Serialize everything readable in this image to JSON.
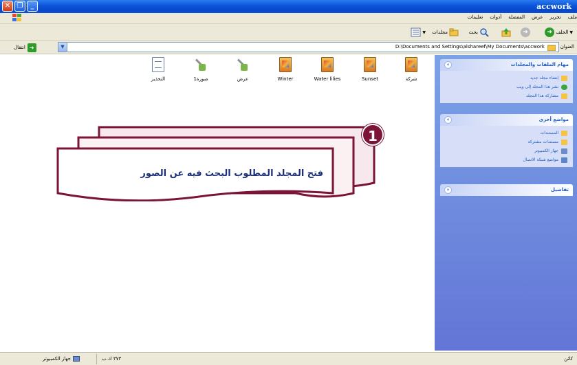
{
  "window": {
    "title": "accwork"
  },
  "menu": [
    "ملف",
    "تحرير",
    "عرض",
    "المفضلة",
    "أدوات",
    "تعليمات"
  ],
  "toolbar": {
    "back_label": "الخلف",
    "search_label": "بحث",
    "folders_label": "مجلدات"
  },
  "address": {
    "label": "العنوان",
    "path": "D:\\Documents and Settings\\alshareef\\My Documents\\accwork",
    "go_label": "انتقال"
  },
  "task_pane": {
    "panels": [
      {
        "title": "مهام الملفات والمجلدات",
        "tasks": [
          {
            "label": "إنشاء مجلد جديد",
            "icon": "new-folder-icon",
            "color": "#f5c445"
          },
          {
            "label": "نشر هذا المجلد إلى ويب",
            "icon": "web-publish-icon",
            "color": "#3aa63a"
          },
          {
            "label": "مشاركة هذا المجلد",
            "icon": "share-folder-icon",
            "color": "#f5c445"
          }
        ]
      },
      {
        "title": "مواضع أخرى",
        "tasks": [
          {
            "label": "المستندات",
            "icon": "documents-icon",
            "color": "#f5c445"
          },
          {
            "label": "مستندات مشتركة",
            "icon": "shared-documents-icon",
            "color": "#f5c445"
          },
          {
            "label": "جهاز الكمبيوتر",
            "icon": "my-computer-icon",
            "color": "#6b8bc9"
          },
          {
            "label": "مواضع شبكة الاتصال",
            "icon": "network-places-icon",
            "color": "#5a86c8"
          }
        ]
      },
      {
        "title": "تفاصيل",
        "tasks": []
      }
    ]
  },
  "files": [
    {
      "name": "شركة",
      "type": "picture"
    },
    {
      "name": "Sunset",
      "type": "picture"
    },
    {
      "name": "Water lilies",
      "type": "picture"
    },
    {
      "name": "Winter",
      "type": "picture"
    },
    {
      "name": "عرض",
      "type": "tool"
    },
    {
      "name": "صورة1",
      "type": "tool"
    },
    {
      "name": "التحذير",
      "type": "document"
    }
  ],
  "callout": {
    "number": "1",
    "text": "فتح المجلد المطلوب البحث فيه عن الصور"
  },
  "status": {
    "zone": "جهاز الكمبيوتر",
    "size": "٣٧٣ ك.ب",
    "end": "كائن"
  },
  "colors": {
    "taskpane": "#6f8ede",
    "callout_border": "#7b1436",
    "callout_text": "#1e2f7a"
  }
}
